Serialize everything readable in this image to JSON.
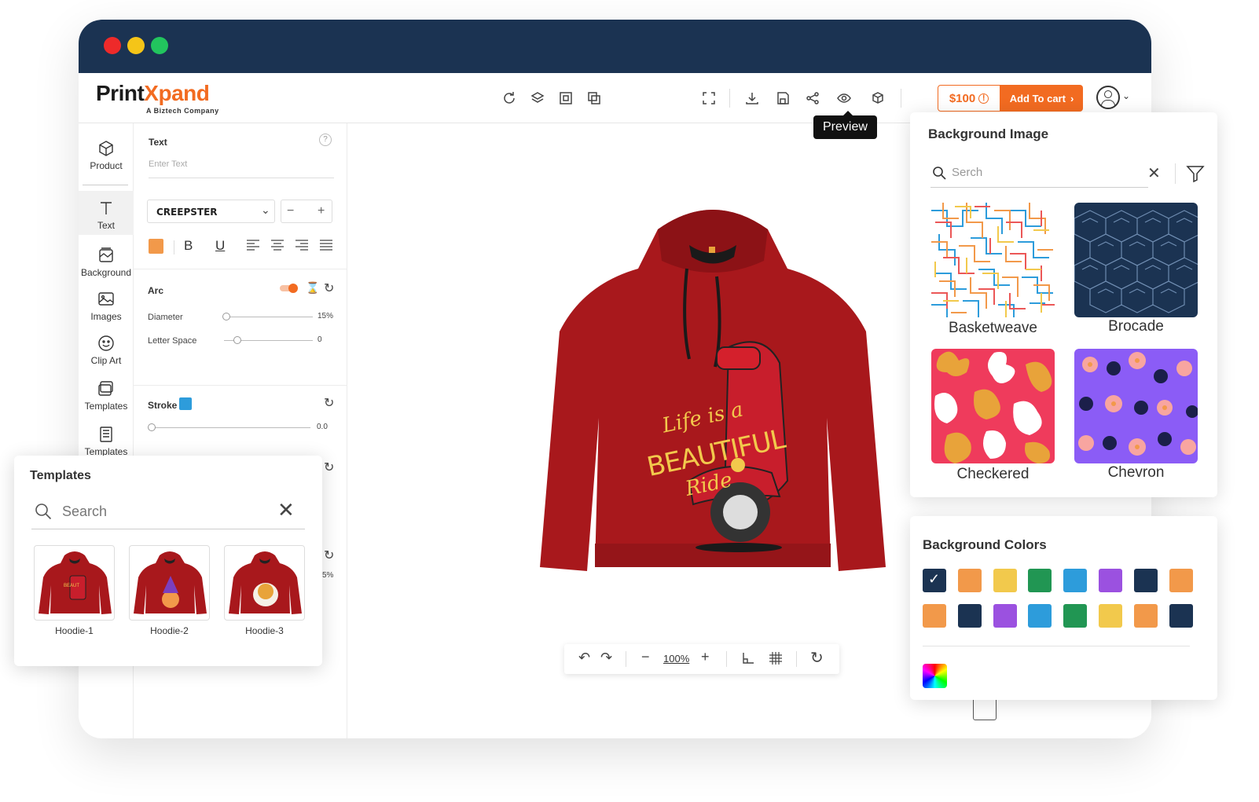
{
  "brand": {
    "logo_prefix": "Print",
    "logo_x": "X",
    "logo_suffix": "pand",
    "subtitle": "A Biztech Company"
  },
  "toolbar": {
    "price": "$100",
    "cart_label": "Add To cart",
    "preview_tooltip": "Preview"
  },
  "rail": {
    "items": [
      {
        "label": "Product"
      },
      {
        "label": "Text"
      },
      {
        "label": "Background"
      },
      {
        "label": "Images"
      },
      {
        "label": "Clip Art"
      },
      {
        "label": "Templates"
      },
      {
        "label": "Templates"
      }
    ]
  },
  "props": {
    "text_label": "Text",
    "text_placeholder": "Enter Text",
    "font_name": "CREEPSTER",
    "font_color": "#f2994a",
    "arc_label": "Arc",
    "diameter_label": "Diameter",
    "diameter_value": "15%",
    "letter_space_label": "Letter Space",
    "letter_space_value": "0",
    "stroke_label": "Stroke",
    "stroke_color": "#2d9cdb",
    "stroke_value": "0.0",
    "extra_value": "5%"
  },
  "canvas": {
    "zoom": "100%",
    "hoodie_text_1": "Life is a",
    "hoodie_text_2": "BEAUTIFUL",
    "hoodie_text_3": "Ride"
  },
  "bg_image": {
    "title": "Background Image",
    "search_placeholder": "Serch",
    "patterns": [
      {
        "label": "Basketweave"
      },
      {
        "label": "Brocade"
      },
      {
        "label": "Checkered"
      },
      {
        "label": "Chevron"
      }
    ]
  },
  "bg_colors": {
    "title": "Background Colors",
    "row1": [
      "#1b3352",
      "#f2994a",
      "#f2c94c",
      "#219653",
      "#2d9cdb",
      "#9b51e0",
      "#1b3352",
      "#f2994a"
    ],
    "row2": [
      "#f2994a",
      "#1b3352",
      "#9b51e0",
      "#2d9cdb",
      "#219653",
      "#f2c94c",
      "#f2994a",
      "#1b3352"
    ]
  },
  "templates": {
    "title": "Templates",
    "search_placeholder": "Search",
    "items": [
      {
        "label": "Hoodie-1"
      },
      {
        "label": "Hoodie-2"
      },
      {
        "label": "Hoodie-3"
      }
    ]
  }
}
